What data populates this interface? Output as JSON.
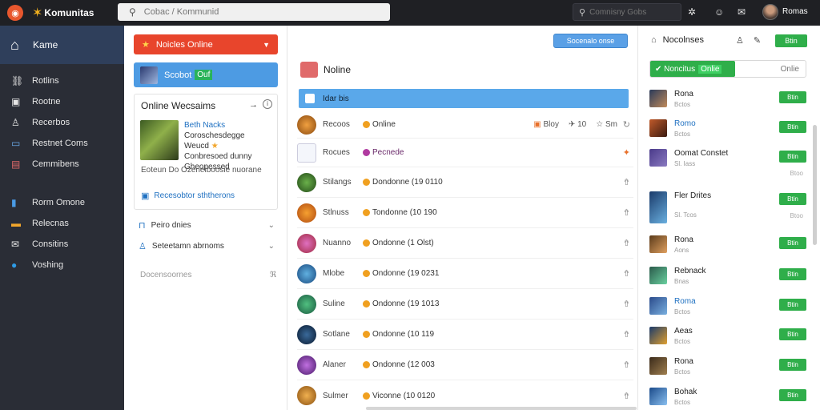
{
  "topbar": {
    "brand": "Komunitas",
    "search_placeholder": "Cobac / Kommunid",
    "search2_placeholder": "Comnisny Gobs",
    "user_name": "Romas"
  },
  "leftnav": {
    "home": "Kame",
    "group1": [
      "Rotlins",
      "Rootne",
      "Recerbos",
      "Restnet Coms",
      "Cemmibens"
    ],
    "group2": [
      "Rorm Omone",
      "Relecnas",
      "Consitins",
      "Voshing"
    ]
  },
  "panel_left": {
    "red_button": "Noicles Online",
    "blue_card_label": "Scobot",
    "blue_card_tag": "Ouf",
    "ow_title": "Online Wecsaims",
    "ow_line1": "Beth Nacks",
    "ow_line2": "Coroschesdegge",
    "ow_line3": "Weucd",
    "ow_line4": "Conbresoed dunny",
    "ow_line5": "Gheopessed",
    "ow_desc": "Eoteun Do Ozeneiboosie nuorane",
    "ow_link": "Recesobtor sththerons",
    "row1": "Peiro dnies",
    "row2": "Seteetamn abrnoms",
    "muted": "Docensoornes",
    "muted_end": "ℜ"
  },
  "panel_center": {
    "top_button": "Socenalo onse",
    "title": "Noline",
    "blue_bar": "Idar bis",
    "rows": [
      {
        "name": "Recoos",
        "status": "Online",
        "meta1": "Bloy",
        "meta2": "10",
        "meta3": "Sm"
      },
      {
        "name": "Rocues",
        "status": "Pecnede",
        "meta1": "",
        "meta2": "",
        "meta3": ""
      },
      {
        "name": "Stilangs",
        "status": "Dondonne (19 0110",
        "meta1": "",
        "meta2": "",
        "meta3": ""
      },
      {
        "name": "Stlnuss",
        "status": "Tondonne (10 190",
        "meta1": "",
        "meta2": "",
        "meta3": ""
      },
      {
        "name": "Nuanno",
        "status": "Ondonne (1 Olst)",
        "meta1": "",
        "meta2": "",
        "meta3": ""
      },
      {
        "name": "Mlobe",
        "status": "Ondonne (19 0231",
        "meta1": "",
        "meta2": "",
        "meta3": ""
      },
      {
        "name": "Suline",
        "status": "Ondonne (19 1013",
        "meta1": "",
        "meta2": "",
        "meta3": ""
      },
      {
        "name": "Sotlane",
        "status": "Ondonne (10 119",
        "meta1": "",
        "meta2": "",
        "meta3": ""
      },
      {
        "name": "Alaner",
        "status": "Ondonne (12 003",
        "meta1": "",
        "meta2": "",
        "meta3": ""
      },
      {
        "name": "Sulmer",
        "status": "Viconne (10 0120",
        "meta1": "",
        "meta2": "",
        "meta3": ""
      }
    ]
  },
  "panel_right": {
    "title": "Nocolnses",
    "join_top": "Btin",
    "seg_on": "Noncitus",
    "seg_on_tag": "Onlie",
    "seg_off": "Onlie",
    "rows": [
      {
        "name": "Rona",
        "sub": "Bctos",
        "join": "Btin"
      },
      {
        "name": "Romo",
        "sub": "Bctos",
        "join": "Btin"
      },
      {
        "name": "Oomat Constet",
        "sub": "Sl. Iass",
        "join": "Btin",
        "joinsub": "Btoo"
      },
      {
        "name": "Fler Drites",
        "sub": "Sl. Tcos",
        "join": "Btin",
        "joinsub": "Btoo"
      },
      {
        "name": "Rona",
        "sub": "Aons",
        "join": "Btin"
      },
      {
        "name": "Rebnack",
        "sub": "Bnas",
        "join": "Btin"
      },
      {
        "name": "Roma",
        "sub": "Bctos",
        "join": "Btin"
      },
      {
        "name": "Aeas",
        "sub": "Bctos",
        "join": "Btin"
      },
      {
        "name": "Rona",
        "sub": "Bctos",
        "join": "Btin"
      },
      {
        "name": "Bohak",
        "sub": "Bctos",
        "join": "Btin"
      }
    ]
  }
}
